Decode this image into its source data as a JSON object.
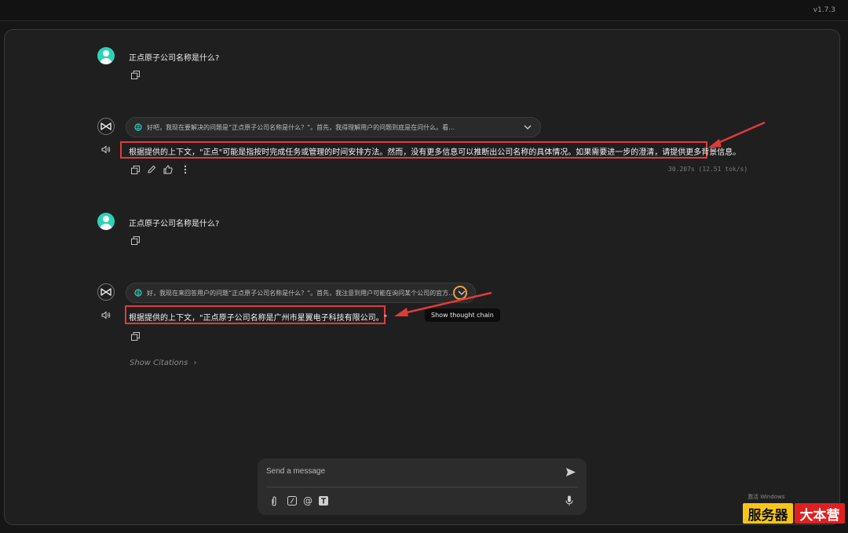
{
  "app": {
    "version": "v1.7.3"
  },
  "conversation": {
    "user_messages": [
      {
        "text": "正点原子公司名称是什么?"
      },
      {
        "text": "正点原子公司名称是什么?"
      }
    ],
    "assistant_messages": [
      {
        "thought_preview": "好吧，我现在要解决的问题是“正点原子公司名称是什么？”。首先，我得理解用户的问题到底是在问什么。看…",
        "answer": "根据提供的上下文，\"正点\"可能是指按时完成任务或管理的时间安排方法。然而，没有更多信息可以推断出公司名称的具体情况。如果需要进一步的澄清，请提供更多背景信息。",
        "timing": "30.207s (12.51 tok/s)"
      },
      {
        "thought_preview": "好，我现在来回答用户的问题“正点原子公司名称是什么？”。首先，我注意到用户可能在询问某个公司的官方…",
        "answer": "根据提供的上下文，\"正点原子公司名称是广州市星翼电子科技有限公司。\"",
        "tooltip": "Show thought chain",
        "citations_label": "Show Citations"
      }
    ]
  },
  "composer": {
    "placeholder": "Send a message"
  },
  "watermark": {
    "activate_windows": "激活 Windows",
    "brand_left": "服务器",
    "brand_right": "大本营"
  },
  "colors": {
    "accent_teal": "#2ed3b7",
    "annotation_red": "#e03b3b",
    "brand_yellow": "#f6c518",
    "brand_red": "#e02020"
  }
}
